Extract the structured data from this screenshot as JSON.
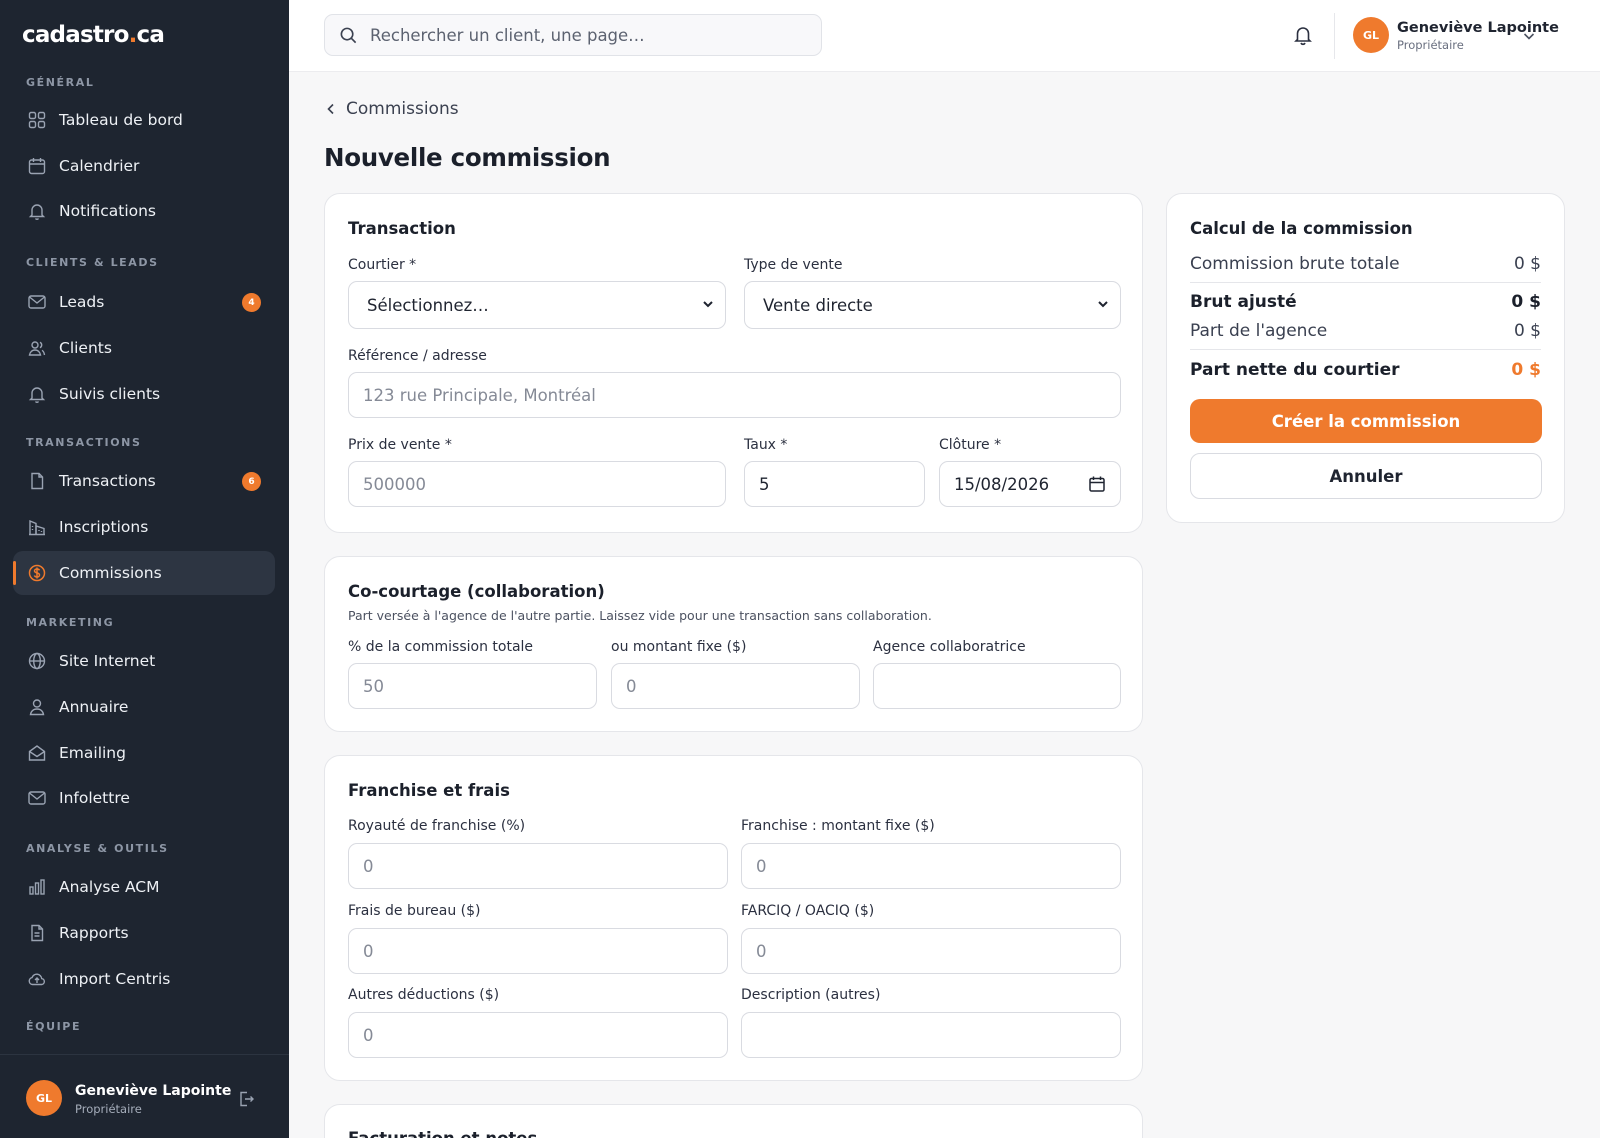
{
  "app": {
    "logo_main": "cadastro",
    "logo_dot": ".",
    "logo_tld": "ca"
  },
  "colors": {
    "accent": "#ef7a2d",
    "sidebar_bg": "#1e2530",
    "main_bg": "#f7f7f8"
  },
  "sidebar": {
    "sections": {
      "general": "GÉNÉRAL",
      "clients": "CLIENTS & LEADS",
      "transactions": "TRANSACTIONS",
      "marketing": "MARKETING",
      "analyse": "ANALYSE & OUTILS",
      "equipe": "ÉQUIPE"
    },
    "items": {
      "dashboard": "Tableau de bord",
      "calendar": "Calendrier",
      "notifications": "Notifications",
      "leads": "Leads",
      "leads_badge": "4",
      "clients": "Clients",
      "suivis": "Suivis clients",
      "transactions": "Transactions",
      "transactions_badge": "6",
      "inscriptions": "Inscriptions",
      "commissions": "Commissions",
      "site": "Site Internet",
      "annuaire": "Annuaire",
      "emailing": "Emailing",
      "infolettre": "Infolettre",
      "acm": "Analyse ACM",
      "rapports": "Rapports",
      "import": "Import Centris"
    },
    "user": {
      "initials": "GL",
      "name": "Geneviève Lapointe",
      "role": "Propriétaire"
    }
  },
  "topbar": {
    "search_placeholder": "Rechercher un client, une page…",
    "user": {
      "initials": "GL",
      "name": "Geneviève Lapointe",
      "role": "Propriétaire"
    }
  },
  "main": {
    "breadcrumb": "Commissions",
    "title": "Nouvelle commission",
    "transaction": {
      "title": "Transaction",
      "courtier_label": "Courtier *",
      "courtier_value": "Sélectionnez…",
      "type_label": "Type de vente",
      "type_value": "Vente directe",
      "ref_label": "Référence / adresse",
      "ref_placeholder": "123 rue Principale, Montréal",
      "prix_label": "Prix de vente *",
      "prix_placeholder": "500000",
      "taux_label": "Taux *",
      "taux_value": "5",
      "cloture_label": "Clôture *",
      "cloture_value": "15/08/2026"
    },
    "cocourtage": {
      "title": "Co-courtage (collaboration)",
      "subtitle": "Part versée à l'agence de l'autre partie. Laissez vide pour une transaction sans collaboration.",
      "pct_label": "% de la commission totale",
      "pct_placeholder": "50",
      "fixe_label": "ou montant fixe ($)",
      "fixe_placeholder": "0",
      "agence_label": "Agence collaboratrice",
      "agence_placeholder": ""
    },
    "franchise": {
      "title": "Franchise et frais",
      "royaute_label": "Royauté de franchise (%)",
      "royaute_placeholder": "0",
      "franchise_fixe_label": "Franchise : montant fixe ($)",
      "franchise_fixe_placeholder": "0",
      "bureau_label": "Frais de bureau ($)",
      "bureau_placeholder": "0",
      "farciq_label": "FARCIQ / OACIQ ($)",
      "farciq_placeholder": "0",
      "autres_label": "Autres déductions ($)",
      "autres_placeholder": "0",
      "desc_label": "Description (autres)",
      "desc_placeholder": ""
    },
    "facturation": {
      "title": "Facturation et notes"
    }
  },
  "summary": {
    "title": "Calcul de la commission",
    "rows": [
      {
        "label": "Commission brute totale",
        "amount": "0 $"
      },
      {
        "label": "Brut ajusté",
        "amount": "0 $"
      },
      {
        "label": "Part de l'agence",
        "amount": "0 $"
      },
      {
        "label": "Part nette du courtier",
        "amount": "0 $"
      }
    ],
    "create_button": "Créer la commission",
    "cancel_button": "Annuler"
  }
}
